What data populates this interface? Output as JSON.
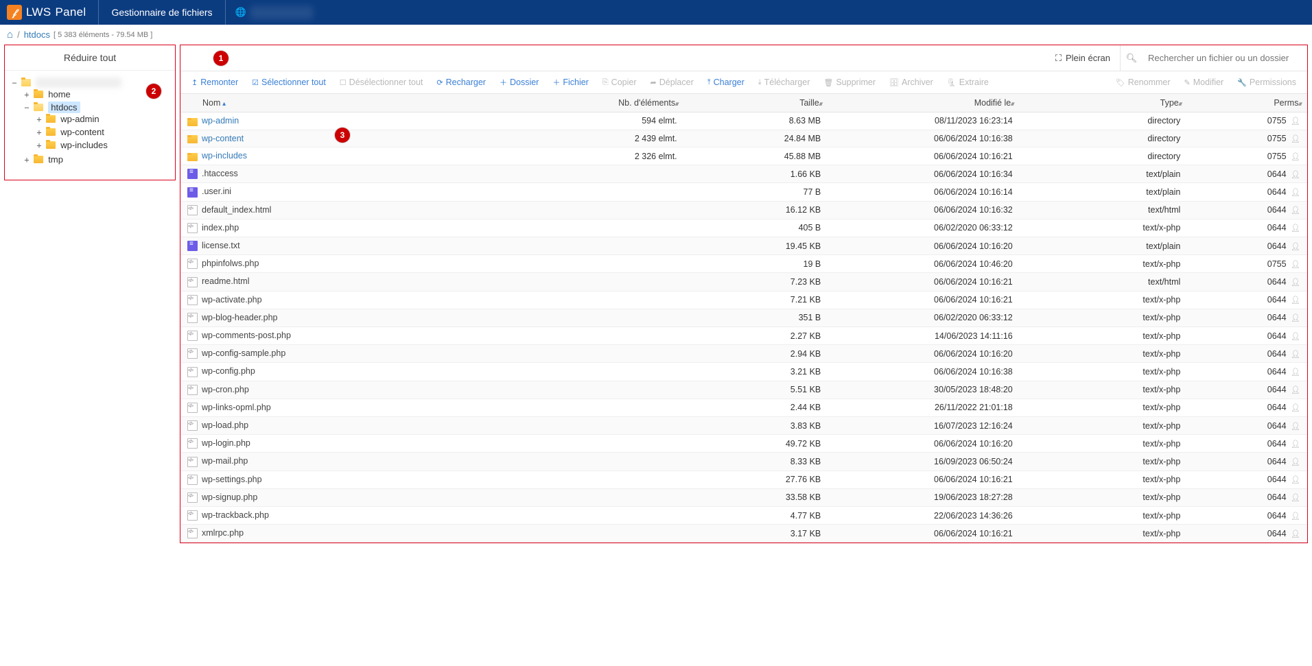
{
  "header": {
    "brand1": "LWS",
    "brand2": "Panel",
    "title": "Gestionnaire de fichiers",
    "domain": "hidden"
  },
  "breadcrumb": {
    "current": "htdocs",
    "info": "[ 5 383 éléments - 79.54 MB ]"
  },
  "sidebar": {
    "collapse_label": "Réduire tout",
    "root_blur": "xxxxxxxxxx",
    "items": {
      "home": "home",
      "htdocs": "htdocs",
      "wp_admin": "wp-admin",
      "wp_content": "wp-content",
      "wp_includes": "wp-includes",
      "tmp": "tmp"
    }
  },
  "topright": {
    "fullscreen": "Plein écran",
    "search_placeholder": "Rechercher un fichier ou un dossier"
  },
  "toolbar": {
    "up": "Remonter",
    "select_all": "Sélectionner tout",
    "deselect_all": "Désélectionner tout",
    "reload": "Recharger",
    "new_folder": "Dossier",
    "new_file": "Fichier",
    "copy": "Copier",
    "move": "Déplacer",
    "upload": "Charger",
    "download": "Télécharger",
    "delete": "Supprimer",
    "archive": "Archiver",
    "extract": "Extraire",
    "rename": "Renommer",
    "edit": "Modifier",
    "permissions": "Permissions"
  },
  "columns": {
    "name": "Nom",
    "count": "Nb. d'éléments",
    "size": "Taille",
    "modified": "Modifié le",
    "type": "Type",
    "perms": "Perms"
  },
  "annotations": {
    "a1": "1",
    "a2": "2",
    "a3": "3"
  },
  "files": [
    {
      "icon": "folder",
      "name": "wp-admin",
      "link": true,
      "count": "594 elmt.",
      "size": "8.63 MB",
      "modified": "08/11/2023 16:23:14",
      "type": "directory",
      "perms": "0755"
    },
    {
      "icon": "folder",
      "name": "wp-content",
      "link": true,
      "count": "2 439 elmt.",
      "size": "24.84 MB",
      "modified": "06/06/2024 10:16:38",
      "type": "directory",
      "perms": "0755"
    },
    {
      "icon": "folder",
      "name": "wp-includes",
      "link": true,
      "count": "2 326 elmt.",
      "size": "45.88 MB",
      "modified": "06/06/2024 10:16:21",
      "type": "directory",
      "perms": "0755"
    },
    {
      "icon": "txt",
      "name": ".htaccess",
      "link": false,
      "count": "",
      "size": "1.66 KB",
      "modified": "06/06/2024 10:16:34",
      "type": "text/plain",
      "perms": "0644"
    },
    {
      "icon": "txt",
      "name": ".user.ini",
      "link": false,
      "count": "",
      "size": "77 B",
      "modified": "06/06/2024 10:16:14",
      "type": "text/plain",
      "perms": "0644"
    },
    {
      "icon": "code",
      "name": "default_index.html",
      "link": false,
      "count": "",
      "size": "16.12 KB",
      "modified": "06/06/2024 10:16:32",
      "type": "text/html",
      "perms": "0644"
    },
    {
      "icon": "code",
      "name": "index.php",
      "link": false,
      "count": "",
      "size": "405 B",
      "modified": "06/02/2020 06:33:12",
      "type": "text/x-php",
      "perms": "0644"
    },
    {
      "icon": "txt",
      "name": "license.txt",
      "link": false,
      "count": "",
      "size": "19.45 KB",
      "modified": "06/06/2024 10:16:20",
      "type": "text/plain",
      "perms": "0644"
    },
    {
      "icon": "code",
      "name": "phpinfolws.php",
      "link": false,
      "count": "",
      "size": "19 B",
      "modified": "06/06/2024 10:46:20",
      "type": "text/x-php",
      "perms": "0755"
    },
    {
      "icon": "code",
      "name": "readme.html",
      "link": false,
      "count": "",
      "size": "7.23 KB",
      "modified": "06/06/2024 10:16:21",
      "type": "text/html",
      "perms": "0644"
    },
    {
      "icon": "code",
      "name": "wp-activate.php",
      "link": false,
      "count": "",
      "size": "7.21 KB",
      "modified": "06/06/2024 10:16:21",
      "type": "text/x-php",
      "perms": "0644"
    },
    {
      "icon": "code",
      "name": "wp-blog-header.php",
      "link": false,
      "count": "",
      "size": "351 B",
      "modified": "06/02/2020 06:33:12",
      "type": "text/x-php",
      "perms": "0644"
    },
    {
      "icon": "code",
      "name": "wp-comments-post.php",
      "link": false,
      "count": "",
      "size": "2.27 KB",
      "modified": "14/06/2023 14:11:16",
      "type": "text/x-php",
      "perms": "0644"
    },
    {
      "icon": "code",
      "name": "wp-config-sample.php",
      "link": false,
      "count": "",
      "size": "2.94 KB",
      "modified": "06/06/2024 10:16:20",
      "type": "text/x-php",
      "perms": "0644"
    },
    {
      "icon": "code",
      "name": "wp-config.php",
      "link": false,
      "count": "",
      "size": "3.21 KB",
      "modified": "06/06/2024 10:16:38",
      "type": "text/x-php",
      "perms": "0644"
    },
    {
      "icon": "code",
      "name": "wp-cron.php",
      "link": false,
      "count": "",
      "size": "5.51 KB",
      "modified": "30/05/2023 18:48:20",
      "type": "text/x-php",
      "perms": "0644"
    },
    {
      "icon": "code",
      "name": "wp-links-opml.php",
      "link": false,
      "count": "",
      "size": "2.44 KB",
      "modified": "26/11/2022 21:01:18",
      "type": "text/x-php",
      "perms": "0644"
    },
    {
      "icon": "code",
      "name": "wp-load.php",
      "link": false,
      "count": "",
      "size": "3.83 KB",
      "modified": "16/07/2023 12:16:24",
      "type": "text/x-php",
      "perms": "0644"
    },
    {
      "icon": "code",
      "name": "wp-login.php",
      "link": false,
      "count": "",
      "size": "49.72 KB",
      "modified": "06/06/2024 10:16:20",
      "type": "text/x-php",
      "perms": "0644"
    },
    {
      "icon": "code",
      "name": "wp-mail.php",
      "link": false,
      "count": "",
      "size": "8.33 KB",
      "modified": "16/09/2023 06:50:24",
      "type": "text/x-php",
      "perms": "0644"
    },
    {
      "icon": "code",
      "name": "wp-settings.php",
      "link": false,
      "count": "",
      "size": "27.76 KB",
      "modified": "06/06/2024 10:16:21",
      "type": "text/x-php",
      "perms": "0644"
    },
    {
      "icon": "code",
      "name": "wp-signup.php",
      "link": false,
      "count": "",
      "size": "33.58 KB",
      "modified": "19/06/2023 18:27:28",
      "type": "text/x-php",
      "perms": "0644"
    },
    {
      "icon": "code",
      "name": "wp-trackback.php",
      "link": false,
      "count": "",
      "size": "4.77 KB",
      "modified": "22/06/2023 14:36:26",
      "type": "text/x-php",
      "perms": "0644"
    },
    {
      "icon": "code",
      "name": "xmlrpc.php",
      "link": false,
      "count": "",
      "size": "3.17 KB",
      "modified": "06/06/2024 10:16:21",
      "type": "text/x-php",
      "perms": "0644"
    }
  ]
}
